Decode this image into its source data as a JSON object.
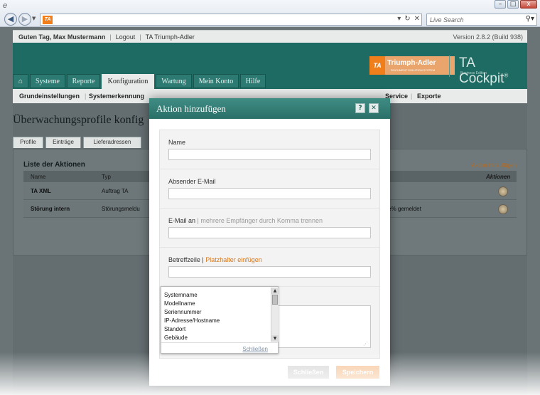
{
  "browser": {
    "search_placeholder": "Live Search",
    "favicon_text": "TA",
    "nav_back": "◀",
    "nav_forward": "▶",
    "addr_buttons": [
      "▾",
      "↻",
      "✕"
    ],
    "window_buttons": [
      "–",
      "□",
      "x"
    ]
  },
  "topbar": {
    "greeting": "Guten Tag, Max Mustermann",
    "logout": "Logout",
    "company": "TA Triumph-Adler",
    "version": "Version 2.8.2 (Build 938)"
  },
  "brand": {
    "logo_block": "TA",
    "logo_text": "Triumph-Adler",
    "tagline": "DOCUMENT SOLUTION SYSTEM",
    "product": "TA Cockpit",
    "reg": "®",
    "edition": "Business Edition"
  },
  "menu": {
    "home_icon": "⌂",
    "items": [
      "Systeme",
      "Reporte",
      "Konfiguration",
      "Wartung",
      "Mein Konto",
      "Hilfe"
    ],
    "active": "Konfiguration"
  },
  "subnav": {
    "items": [
      "Grundeinstellungen",
      "Systemerkennung",
      "Service",
      "Exporte"
    ],
    "separator": "|"
  },
  "page": {
    "title": "Überwachungsprofile konfig",
    "tabs": [
      "Profile",
      "Einträge",
      "Lieferadressen"
    ]
  },
  "list": {
    "title": "Liste der Aktionen",
    "add_link": "Aktion hinzufügen",
    "columns": [
      "Name",
      "Typ",
      "Aktionen"
    ],
    "rows": [
      {
        "name": "TA XML",
        "type": "Auftrag TA",
        "extra": ""
      },
      {
        "name": "Störung intern",
        "type": "Störungsmeldu",
        "extra": "ame% gemeldet"
      }
    ]
  },
  "dialog": {
    "title": "Aktion hinzufügen",
    "help_button": "?",
    "close_button": "✕",
    "fields": {
      "name": {
        "label": "Name",
        "value": ""
      },
      "sender": {
        "label": "Absender E-Mail",
        "value": ""
      },
      "recipient": {
        "label": "E-Mail an",
        "hint": "| mehrere Empfänger durch Komma trennen",
        "value": ""
      },
      "subject": {
        "label": "Betreffzeile |",
        "hint_link": "Platzhalter einfügen",
        "value": ""
      }
    },
    "placeholder_options": [
      "Systemname",
      "Modellname",
      "Seriennummer",
      "IP-Adresse/Hostname",
      "Standort",
      "Gebäude"
    ],
    "dropdown_close": "Schließen",
    "buttons": {
      "close": "Schließen",
      "save": "Speichern"
    }
  },
  "colors": {
    "accent_teal": "#2a6f68",
    "accent_orange": "#f07e1a",
    "link_orange": "#d7771c"
  }
}
